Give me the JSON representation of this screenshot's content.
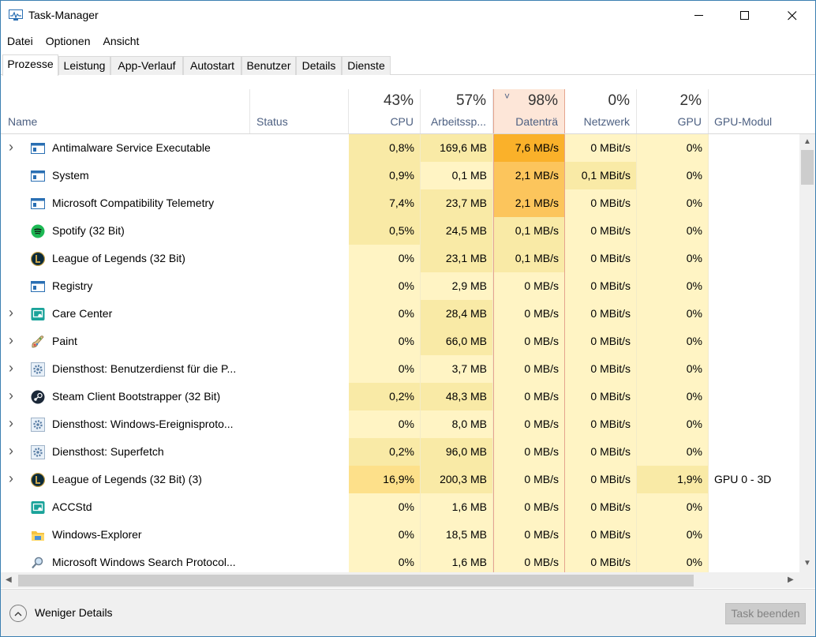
{
  "window": {
    "title": "Task-Manager"
  },
  "menu": [
    "Datei",
    "Optionen",
    "Ansicht"
  ],
  "tabs": [
    {
      "label": "Prozesse",
      "active": true
    },
    {
      "label": "Leistung"
    },
    {
      "label": "App-Verlauf"
    },
    {
      "label": "Autostart"
    },
    {
      "label": "Benutzer"
    },
    {
      "label": "Details"
    },
    {
      "label": "Dienste"
    }
  ],
  "columns": {
    "name": {
      "label": "Name"
    },
    "status": {
      "label": "Status"
    },
    "cpu": {
      "label": "CPU",
      "percent": "43%"
    },
    "mem": {
      "label": "Arbeitssp...",
      "percent": "57%"
    },
    "disk": {
      "label": "Datenträ",
      "percent": "98%",
      "sort_indicator": "˅"
    },
    "net": {
      "label": "Netzwerk",
      "percent": "0%"
    },
    "gpu": {
      "label": "GPU",
      "percent": "2%"
    },
    "gpuengine": {
      "label": "GPU-Modul"
    }
  },
  "heat_colors": {
    "none": "#fff4c4",
    "light": "#fdf0b6",
    "medium": "#f9eaa6",
    "strong": "#fde08a",
    "hot": "#fcc55c",
    "hottest": "#fab12a"
  },
  "rows": [
    {
      "name": "Antimalware Service Executable",
      "expandable": true,
      "icon": "window-process-icon",
      "cpu": "0,8%",
      "mem": "169,6 MB",
      "disk": "7,6 MB/s",
      "net": "0 MBit/s",
      "gpu": "0%",
      "gpuengine": ""
    },
    {
      "name": "System",
      "expandable": false,
      "icon": "window-process-icon",
      "cpu": "0,9%",
      "mem": "0,1 MB",
      "disk": "2,1 MB/s",
      "net": "0,1 MBit/s",
      "gpu": "0%",
      "gpuengine": ""
    },
    {
      "name": "Microsoft Compatibility Telemetry",
      "expandable": false,
      "icon": "window-process-icon",
      "cpu": "7,4%",
      "mem": "23,7 MB",
      "disk": "2,1 MB/s",
      "net": "0 MBit/s",
      "gpu": "0%",
      "gpuengine": ""
    },
    {
      "name": "Spotify (32 Bit)",
      "expandable": false,
      "icon": "spotify-icon",
      "cpu": "0,5%",
      "mem": "24,5 MB",
      "disk": "0,1 MB/s",
      "net": "0 MBit/s",
      "gpu": "0%",
      "gpuengine": ""
    },
    {
      "name": "League of Legends (32 Bit)",
      "expandable": false,
      "icon": "league-icon",
      "cpu": "0%",
      "mem": "23,1 MB",
      "disk": "0,1 MB/s",
      "net": "0 MBit/s",
      "gpu": "0%",
      "gpuengine": ""
    },
    {
      "name": "Registry",
      "expandable": false,
      "icon": "window-process-icon",
      "cpu": "0%",
      "mem": "2,9 MB",
      "disk": "0 MB/s",
      "net": "0 MBit/s",
      "gpu": "0%",
      "gpuengine": ""
    },
    {
      "name": "Care Center",
      "expandable": true,
      "icon": "care-center-icon",
      "cpu": "0%",
      "mem": "28,4 MB",
      "disk": "0 MB/s",
      "net": "0 MBit/s",
      "gpu": "0%",
      "gpuengine": ""
    },
    {
      "name": "Paint",
      "expandable": true,
      "icon": "paint-icon",
      "cpu": "0%",
      "mem": "66,0 MB",
      "disk": "0 MB/s",
      "net": "0 MBit/s",
      "gpu": "0%",
      "gpuengine": ""
    },
    {
      "name": "Diensthost: Benutzerdienst für die P...",
      "expandable": true,
      "icon": "gear-icon",
      "cpu": "0%",
      "mem": "3,7 MB",
      "disk": "0 MB/s",
      "net": "0 MBit/s",
      "gpu": "0%",
      "gpuengine": ""
    },
    {
      "name": "Steam Client Bootstrapper (32 Bit)",
      "expandable": true,
      "icon": "steam-icon",
      "cpu": "0,2%",
      "mem": "48,3 MB",
      "disk": "0 MB/s",
      "net": "0 MBit/s",
      "gpu": "0%",
      "gpuengine": ""
    },
    {
      "name": "Diensthost: Windows-Ereignisproto...",
      "expandable": true,
      "icon": "gear-icon",
      "cpu": "0%",
      "mem": "8,0 MB",
      "disk": "0 MB/s",
      "net": "0 MBit/s",
      "gpu": "0%",
      "gpuengine": ""
    },
    {
      "name": "Diensthost: Superfetch",
      "expandable": true,
      "icon": "gear-icon",
      "cpu": "0,2%",
      "mem": "96,0 MB",
      "disk": "0 MB/s",
      "net": "0 MBit/s",
      "gpu": "0%",
      "gpuengine": ""
    },
    {
      "name": "League of Legends (32 Bit) (3)",
      "expandable": true,
      "icon": "league-icon",
      "cpu": "16,9%",
      "mem": "200,3 MB",
      "disk": "0 MB/s",
      "net": "0 MBit/s",
      "gpu": "1,9%",
      "gpuengine": "GPU 0 - 3D"
    },
    {
      "name": "ACCStd",
      "expandable": false,
      "icon": "care-center-icon",
      "cpu": "0%",
      "mem": "1,6 MB",
      "disk": "0 MB/s",
      "net": "0 MBit/s",
      "gpu": "0%",
      "gpuengine": ""
    },
    {
      "name": "Windows-Explorer",
      "expandable": false,
      "icon": "folder-icon",
      "cpu": "0%",
      "mem": "18,5 MB",
      "disk": "0 MB/s",
      "net": "0 MBit/s",
      "gpu": "0%",
      "gpuengine": ""
    },
    {
      "name": "Microsoft Windows Search Protocol...",
      "expandable": false,
      "icon": "search-protocol-icon",
      "cpu": "0%",
      "mem": "1,6 MB",
      "disk": "0 MB/s",
      "net": "0 MBit/s",
      "gpu": "0%",
      "gpuengine": ""
    }
  ],
  "footer": {
    "fewer_details": "Weniger Details",
    "end_task": "Task beenden"
  }
}
